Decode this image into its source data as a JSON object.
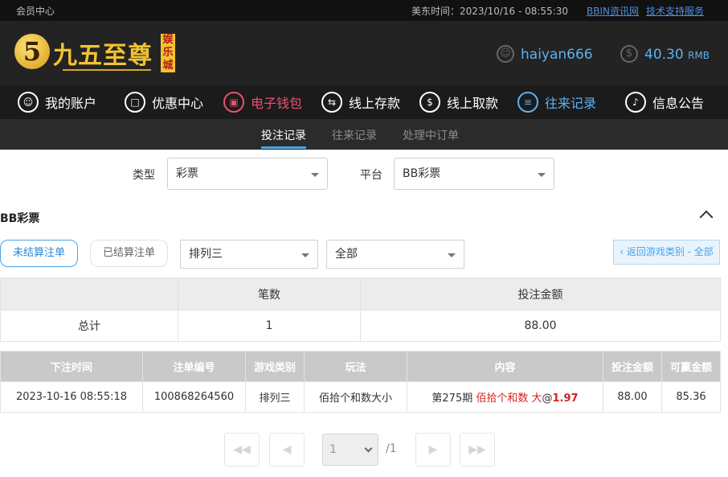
{
  "topbar": {
    "member_center": "会员中心",
    "time_label": "美东时间：2023/10/16 - 08:55:30",
    "bbin_link": "BBIN资讯网",
    "support_link": "技术支持服务"
  },
  "brand": {
    "logo_digit": "5",
    "logo_name": "九五至尊",
    "logo_sub": "娱乐城"
  },
  "account": {
    "username": "haiyan666",
    "balance": "40.30",
    "currency": "RMB"
  },
  "nav": [
    {
      "label": "我的账户",
      "icon": "user-icon"
    },
    {
      "label": "优惠中心",
      "icon": "gift-icon"
    },
    {
      "label": "电子钱包",
      "icon": "wallet-icon"
    },
    {
      "label": "线上存款",
      "icon": "deposit-icon"
    },
    {
      "label": "线上取款",
      "icon": "withdraw-icon"
    },
    {
      "label": "往来记录",
      "icon": "records-icon"
    },
    {
      "label": "信息公告",
      "icon": "bell-icon"
    }
  ],
  "subtabs": [
    "投注记录",
    "往来记录",
    "处理中订单"
  ],
  "filters": {
    "type_label": "类型",
    "type_value": "彩票",
    "platform_label": "平台",
    "platform_value": "BB彩票"
  },
  "section": {
    "title": "BB彩票",
    "unsettled": "未结算注单",
    "settled": "已结算注单",
    "game_value": "排列三",
    "scope_value": "全部",
    "back_button": "‹ 返回游戏类别 - 全部"
  },
  "summary": {
    "headers": [
      "",
      "笔数",
      "投注金额"
    ],
    "row": [
      "总计",
      "1",
      "88.00"
    ]
  },
  "detail": {
    "headers": [
      "下注时间",
      "注单编号",
      "游戏类别",
      "玩法",
      "内容",
      "投注金额",
      "可赢金额"
    ],
    "row": {
      "time": "2023-10-16 08:55:18",
      "order_no": "100868264560",
      "game": "排列三",
      "play": "佰拾个和数大小",
      "content_period": "第275期 ",
      "content_pick": "佰拾个和数 大",
      "content_at": "@",
      "content_odds": "1.97",
      "bet": "88.00",
      "win": "85.36"
    }
  },
  "pagination": {
    "current": "1",
    "total": "/1"
  },
  "colors": {
    "accent_blue": "#4aa3e8",
    "highlight_red": "#d21f1f",
    "nav_pink": "#e9516e",
    "logo_gold": "#f2c230"
  }
}
